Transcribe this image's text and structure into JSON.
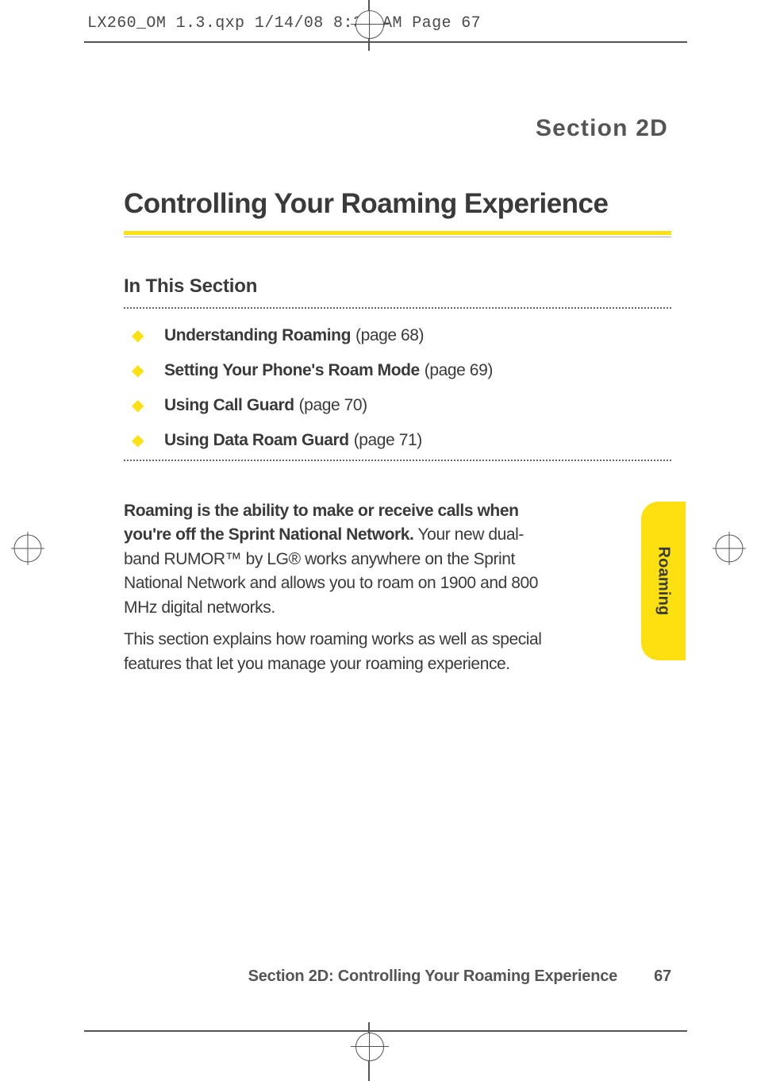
{
  "header_slug": "LX260_OM 1.3.qxp  1/14/08  8:35 AM  Page 67",
  "section_label": "Section 2D",
  "chapter_title": "Controlling Your Roaming Experience",
  "subhead": "In This Section",
  "toc": [
    {
      "title": "Understanding Roaming",
      "page": "(page 68)"
    },
    {
      "title": "Setting Your Phone's Roam Mode",
      "page": "(page 69)"
    },
    {
      "title": "Using Call Guard",
      "page": "(page 70)"
    },
    {
      "title": "Using Data Roam Guard",
      "page": "(page 71)"
    }
  ],
  "body": {
    "lead": "Roaming is the ability to make or receive calls when you're off the Sprint National Network.",
    "para1_rest": " Your new dual-band RUMOR™ by LG® works anywhere on the Sprint National Network and allows you to roam on 1900 and 800 MHz digital networks.",
    "para2": "This section explains how roaming works as well as special features that let you manage your roaming experience."
  },
  "side_tab": "Roaming",
  "footer": {
    "title": "Section 2D: Controlling Your Roaming Experience",
    "page": "67"
  }
}
